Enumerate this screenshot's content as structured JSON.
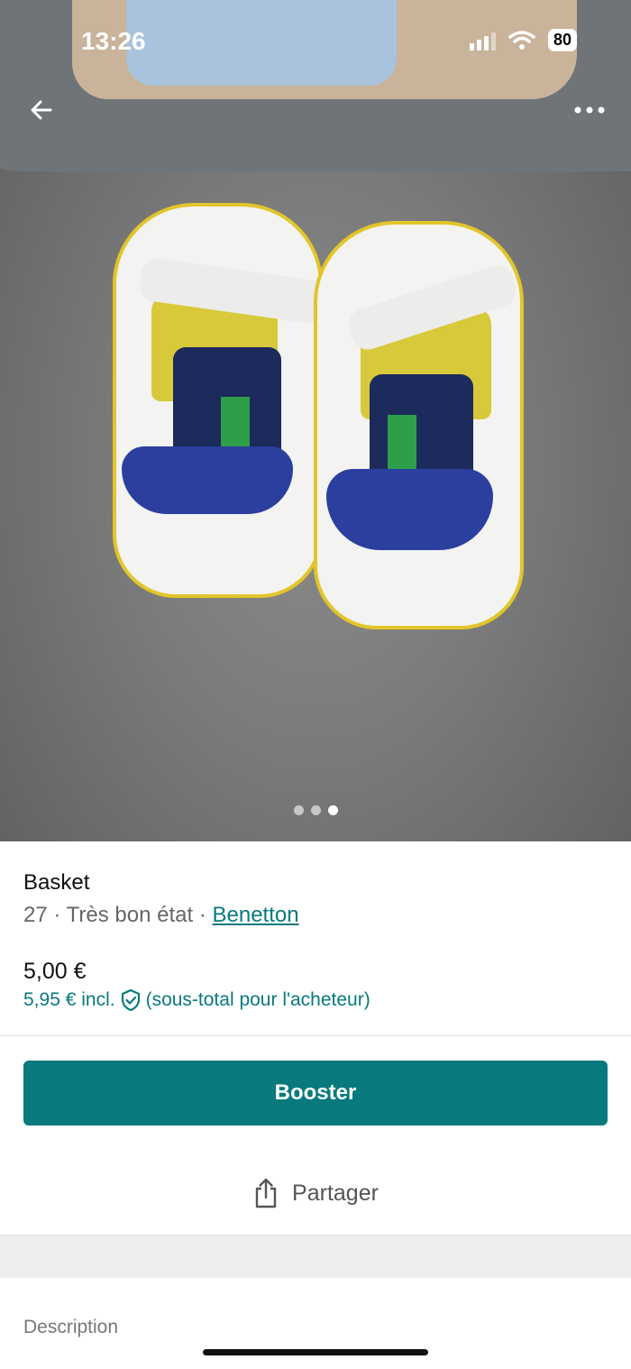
{
  "status_bar": {
    "time": "13:26",
    "battery": "80"
  },
  "gallery": {
    "image_count": 3,
    "active_index": 2
  },
  "item": {
    "title": "Basket",
    "size": "27",
    "separator": "·",
    "condition": "Très bon état",
    "brand": "Benetton",
    "price": "5,00 €",
    "price_incl": "5,95 € incl.",
    "price_incl_note": "(sous-total pour l'acheteur)"
  },
  "actions": {
    "booster_label": "Booster",
    "share_label": "Partager"
  },
  "description": {
    "label": "Description"
  },
  "colors": {
    "accent": "#087a7e",
    "text": "#111111",
    "muted": "#666666"
  },
  "icons": [
    "arrow-left-icon",
    "more-horizontal-icon",
    "shield-check-icon",
    "share-icon"
  ]
}
